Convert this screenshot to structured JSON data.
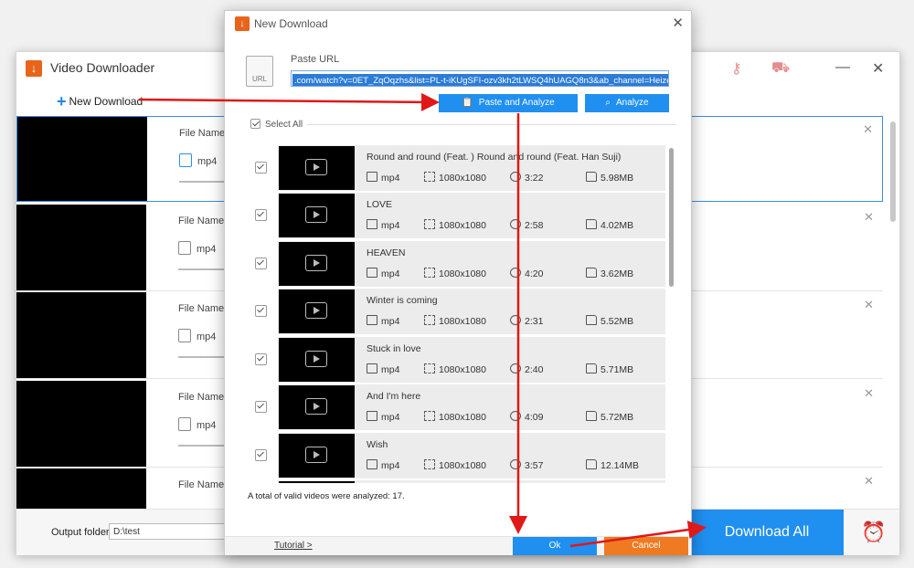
{
  "main": {
    "title": "Video Downloader",
    "new_download_label": "New Download",
    "output_folder_label": "Output folder:",
    "output_folder_value": "D:\\test",
    "download_all_label": "Download All",
    "items": [
      {
        "file_name_label": "File Name:",
        "format": "mp4"
      },
      {
        "file_name_label": "File Name:",
        "format": "mp4"
      },
      {
        "file_name_label": "File Name:",
        "format": "mp4"
      },
      {
        "file_name_label": "File Name:",
        "format": "mp4"
      },
      {
        "file_name_label": "File Name:",
        "format": ""
      }
    ]
  },
  "dialog": {
    "title": "New Download",
    "paste_url_label": "Paste URL",
    "url_value": ".com/watch?v=0ET_ZqOqzhs&list=PL-t-iKUgSFI-ozv3kh2tLWSQ4hUAGQ8n3&ab_channel=Heize-Topic",
    "url_icon_text": "URL",
    "paste_analyze_label": "Paste and Analyze",
    "analyze_label": "Analyze",
    "select_all_label": "Select All",
    "videos": [
      {
        "title": "Round and round (Feat. ) Round and round (Feat. Han Suji)",
        "format": "mp4",
        "resolution": "1080x1080",
        "duration": "3:22",
        "size": "5.98MB"
      },
      {
        "title": "LOVE",
        "format": "mp4",
        "resolution": "1080x1080",
        "duration": "2:58",
        "size": "4.02MB"
      },
      {
        "title": "HEAVEN",
        "format": "mp4",
        "resolution": "1080x1080",
        "duration": "4:20",
        "size": "3.62MB"
      },
      {
        "title": "Winter is coming",
        "format": "mp4",
        "resolution": "1080x1080",
        "duration": "2:31",
        "size": "5.52MB"
      },
      {
        "title": "Stuck in love",
        "format": "mp4",
        "resolution": "1080x1080",
        "duration": "2:40",
        "size": "5.71MB"
      },
      {
        "title": "And I'm here",
        "format": "mp4",
        "resolution": "1080x1080",
        "duration": "4:09",
        "size": "5.72MB"
      },
      {
        "title": "Wish",
        "format": "mp4",
        "resolution": "1080x1080",
        "duration": "3:57",
        "size": "12.14MB"
      }
    ],
    "total_text": "A total of valid videos were analyzed: 17.",
    "tutorial_label": "Tutorial >",
    "ok_label": "Ok",
    "cancel_label": "Cancel"
  },
  "colors": {
    "accent": "#1f8ff0",
    "cancel": "#f07a22",
    "logo": "#e8641b",
    "arrow": "#e01818"
  }
}
